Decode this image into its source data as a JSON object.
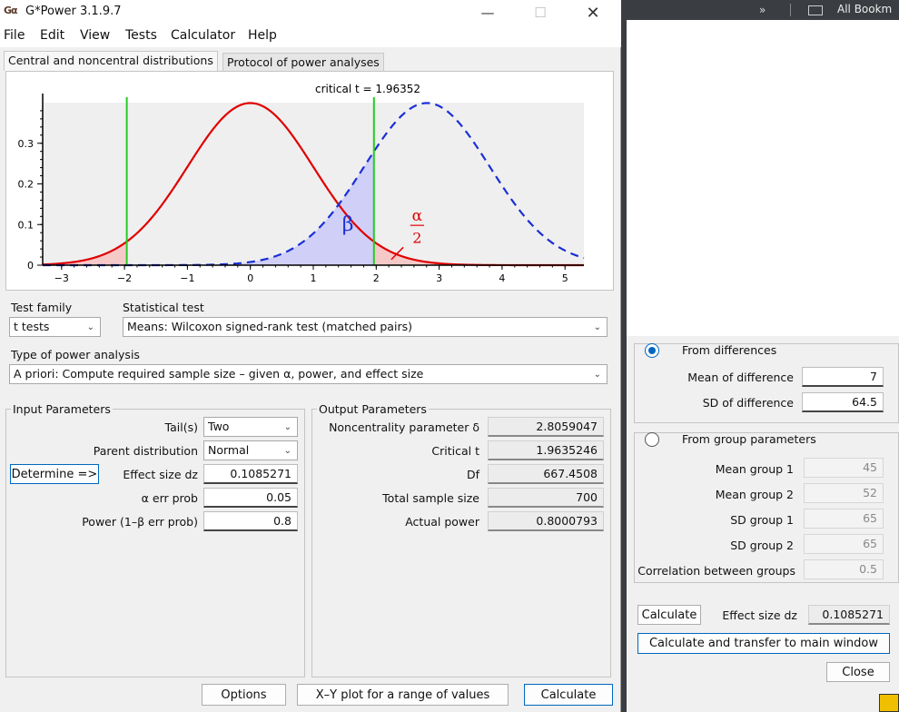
{
  "window": {
    "app_icon": "Gα",
    "title": "G*Power 3.1.9.7",
    "minimize": "—",
    "maximize": "☐",
    "close": "✕"
  },
  "menu": [
    "File",
    "Edit",
    "View",
    "Tests",
    "Calculator",
    "Help"
  ],
  "tabs": [
    {
      "label": "Central and noncentral distributions",
      "active": true
    },
    {
      "label": "Protocol of power analyses",
      "active": false
    }
  ],
  "chart_data": {
    "type": "line",
    "title": "critical t =  1.96352",
    "critical_t": 1.96352,
    "noncentrality": 2.8059047,
    "xlim": [
      -3.3,
      5.3
    ],
    "ylim": [
      0,
      0.4
    ],
    "x_ticks": [
      -3,
      -2,
      -1,
      0,
      1,
      2,
      3,
      4,
      5
    ],
    "y_ticks": [
      0,
      0.1,
      0.2,
      0.3
    ],
    "series": [
      {
        "name": "",
        "style": "solid",
        "color": "#e00000",
        "mean": 0,
        "sd": 1
      },
      {
        "name": "",
        "style": "dashed",
        "color": "#1a2fd6",
        "mean": 2.8059,
        "sd": 1
      }
    ],
    "critical_lines": [
      -1.96352,
      1.96352
    ],
    "annotations": {
      "beta": "β",
      "alpha_num": "α",
      "alpha_den": "2"
    }
  },
  "test_family": {
    "label": "Test family",
    "value": "t tests"
  },
  "statistical_test": {
    "label": "Statistical test",
    "value": "Means: Wilcoxon signed-rank test (matched pairs)"
  },
  "power_analysis": {
    "label": "Type of power analysis",
    "value": "A priori: Compute required sample size – given α, power, and effect size"
  },
  "input": {
    "title": "Input Parameters",
    "tails_label": "Tail(s)",
    "tails_value": "Two",
    "parent_label": "Parent distribution",
    "parent_value": "Normal",
    "determine_label": "Determine =>",
    "effect_label": "Effect size dz",
    "effect_value": "0.1085271",
    "alpha_label": "α err prob",
    "alpha_value": "0.05",
    "power_label": "Power (1–β err prob)",
    "power_value": "0.8"
  },
  "output": {
    "title": "Output Parameters",
    "ncp_label": "Noncentrality parameter δ",
    "ncp_value": "2.8059047",
    "crit_label": "Critical t",
    "crit_value": "1.9635246",
    "df_label": "Df",
    "df_value": "667.4508",
    "n_label": "Total sample size",
    "n_value": "700",
    "power_label": "Actual power",
    "power_value": "0.8000793"
  },
  "buttons": {
    "options": "Options",
    "xy_plot": "X–Y plot for a range of values",
    "calculate": "Calculate"
  },
  "effect_panel": {
    "from_diff": "From differences",
    "mean_diff_label": "Mean of difference",
    "mean_diff_value": "7",
    "sd_diff_label": "SD of difference",
    "sd_diff_value": "64.5",
    "from_group": "From group parameters",
    "mean1_label": "Mean group 1",
    "mean1_value": "45",
    "mean2_label": "Mean group 2",
    "mean2_value": "52",
    "sd1_label": "SD group 1",
    "sd1_value": "65",
    "sd2_label": "SD group 2",
    "sd2_value": "65",
    "corr_label": "Correlation between groups",
    "corr_value": "0.5",
    "calc_label": "Calculate",
    "es_label": "Effect size dz",
    "es_value": "0.1085271",
    "calc_transfer_label": "Calculate and transfer to main window",
    "close_label": "Close"
  },
  "background_bar": {
    "text": "All Bookm",
    "chevrons": "»"
  }
}
